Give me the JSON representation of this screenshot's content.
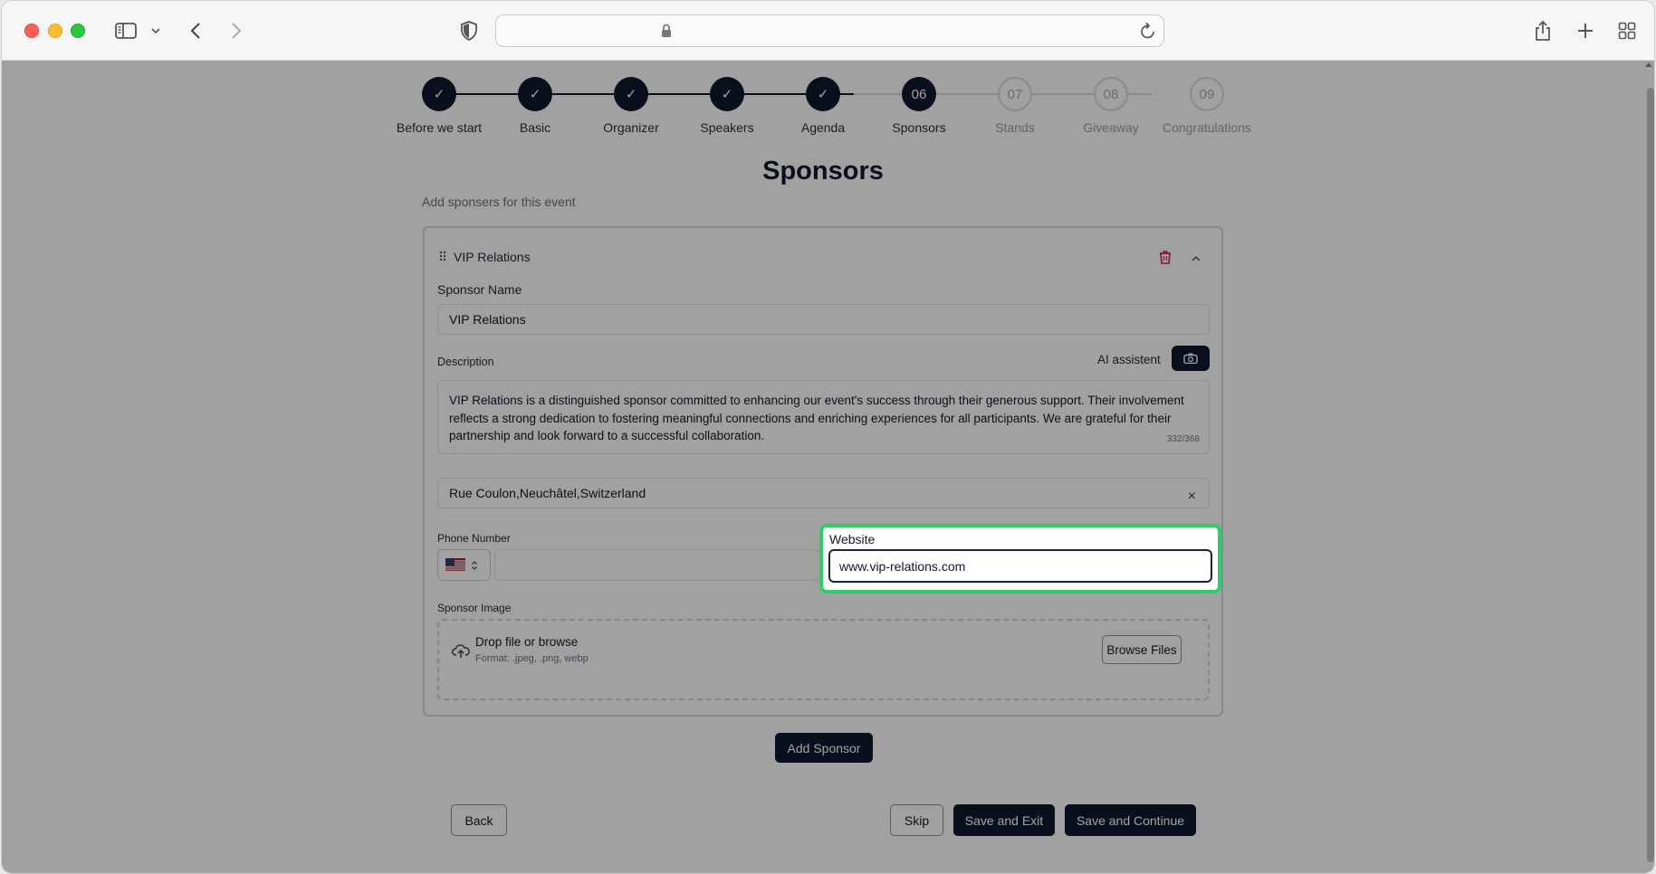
{
  "stepper": {
    "steps": [
      {
        "label": "Before we start",
        "num": "✓",
        "state": "done"
      },
      {
        "label": "Basic",
        "num": "✓",
        "state": "done"
      },
      {
        "label": "Organizer",
        "num": "✓",
        "state": "done"
      },
      {
        "label": "Speakers",
        "num": "✓",
        "state": "done"
      },
      {
        "label": "Agenda",
        "num": "✓",
        "state": "done"
      },
      {
        "label": "Sponsors",
        "num": "06",
        "state": "current"
      },
      {
        "label": "Stands",
        "num": "07",
        "state": "todo"
      },
      {
        "label": "Giveaway",
        "num": "08",
        "state": "todo"
      },
      {
        "label": "Congratulations",
        "num": "09",
        "state": "todo"
      }
    ]
  },
  "page": {
    "title": "Sponsors",
    "subtitle": "Add sponsers for this event"
  },
  "sponsor": {
    "header": "VIP Relations",
    "name_label": "Sponsor Name",
    "name_value": "VIP Relations",
    "description_label": "Description",
    "ai_label": "AI assistent",
    "description_value": "VIP Relations is a distinguished sponsor committed to enhancing our event's success through their generous support. Their involvement reflects a strong dedication to fostering meaningful connections and enriching experiences for all participants. We are grateful for their partnership and look forward to a successful collaboration.",
    "char_count": "332/368",
    "address_value": "Rue Coulon,Neuchâtel,Switzerland",
    "clear_symbol": "×",
    "phone_label": "Phone Number",
    "website_label": "Website",
    "website_value": "www.vip-relations.com",
    "image_label": "Sponsor Image",
    "drop_title": "Drop file or browse",
    "drop_format": "Format: .jpeg, .png, webp",
    "browse_label": "Browse Files"
  },
  "actions": {
    "add_sponsor": "Add Sponsor",
    "back": "Back",
    "skip": "Skip",
    "save_exit": "Save and Exit",
    "save_continue": "Save and Continue"
  },
  "colors": {
    "primary": "#10192f",
    "highlight": "#2fcc6a",
    "danger": "#e11d48"
  }
}
